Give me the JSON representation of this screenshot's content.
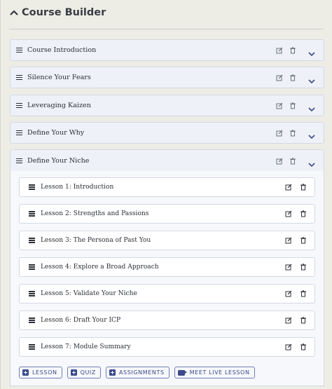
{
  "header": {
    "title": "Course Builder"
  },
  "modules": [
    {
      "label": "Course Introduction"
    },
    {
      "label": "Silence Your Fears"
    },
    {
      "label": "Leveraging Kaizen"
    },
    {
      "label": "Define Your Why"
    },
    {
      "label": "Define Your Niche"
    }
  ],
  "lessons": [
    {
      "label": "Lesson 1: Introduction"
    },
    {
      "label": "Lesson 2: Strengths and Passions"
    },
    {
      "label": "Lesson 3: The Persona of Past You"
    },
    {
      "label": "Lesson 4: Explore a Broad Approach"
    },
    {
      "label": "Lesson 5: Validate Your Niche"
    },
    {
      "label": "Lesson 6: Draft Your ICP"
    },
    {
      "label": "Lesson 7: Module Summary"
    }
  ],
  "buttons": {
    "lesson": "LESSON",
    "quiz": "QUIZ",
    "assignments": "ASSIGNMENTS",
    "live": "MEET LIVE LESSON"
  },
  "colors": {
    "accent": "#3b4a8a",
    "chevron": "#3b4a8a"
  }
}
